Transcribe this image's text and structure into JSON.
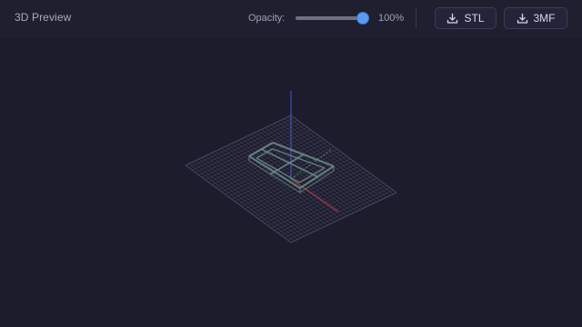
{
  "toolbar": {
    "title": "3D Preview",
    "opacity_label": "Opacity:",
    "opacity_value": "100%",
    "opacity_level": 1.0,
    "export_buttons": [
      {
        "label": "STL",
        "icon": "download-icon"
      },
      {
        "label": "3MF",
        "icon": "download-icon"
      }
    ]
  },
  "viewport": {
    "background": "#1c1c2d",
    "grid_color": "#4f4a66",
    "model_color": "#6f8c86",
    "axis_colors": {
      "x": "#c0454c",
      "y": "#4fae5a",
      "z": "#4a56c6"
    }
  }
}
